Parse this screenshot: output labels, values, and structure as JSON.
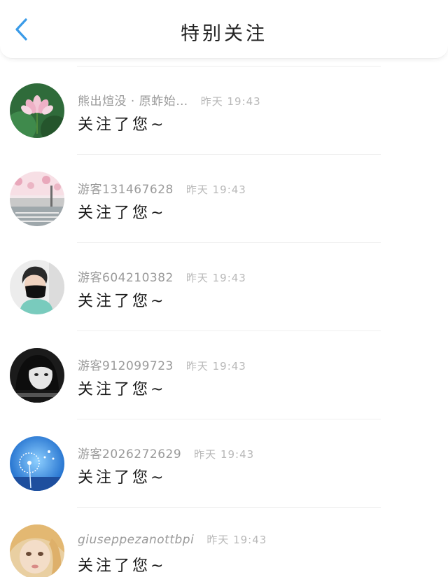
{
  "header": {
    "title": "特别关注",
    "back_icon": "chevron-left-icon",
    "accent_color": "#3a9be8"
  },
  "rows": [
    {
      "username": "熊出煊没 · 原蚱始…",
      "time": "昨天 19:43",
      "message": "关注了您~",
      "avatar": "lotus-flower"
    },
    {
      "username": "游客131467628",
      "time": "昨天 19:43",
      "message": "关注了您~",
      "avatar": "street-scene"
    },
    {
      "username": "游客604210382",
      "time": "昨天 19:43",
      "message": "关注了您~",
      "avatar": "masked-person"
    },
    {
      "username": "游客912099723",
      "time": "昨天 19:43",
      "message": "关注了您~",
      "avatar": "bw-portrait"
    },
    {
      "username": "游客2026272629",
      "time": "昨天 19:43",
      "message": "关注了您~",
      "avatar": "dandelion-sky"
    },
    {
      "username": "giuseppezanottbpi",
      "time": "昨天 19:43",
      "message": "关注了您~",
      "avatar": "doll-face"
    }
  ]
}
